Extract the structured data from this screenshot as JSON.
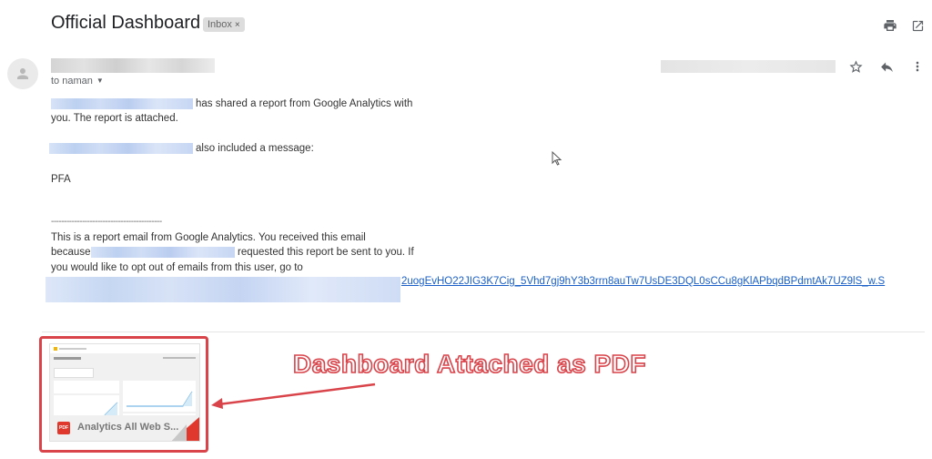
{
  "header": {
    "subject": "Official Dashboard",
    "label_badge": "Inbox",
    "label_remove": "×",
    "print_icon": "print-icon",
    "popout_icon": "open-in-new-window-icon"
  },
  "message": {
    "sender_name": "[redacted]",
    "to_line": "to naman",
    "date": "[redacted]",
    "actions": {
      "star_icon": "star-icon",
      "reply_icon": "reply-icon",
      "more_icon": "more-vertical-icon"
    },
    "body": {
      "line1_suffix": "has shared a report from Google Analytics with",
      "line2": "you. The report is attached.",
      "line3_suffix": "also included a message:",
      "message_text": "PFA",
      "separator": "-------------------------------------------",
      "footer_line1": "This is a report email from Google Analytics. You received this email",
      "footer_line2_prefix": "because",
      "footer_line2_suffix": "requested this report be sent to you. If",
      "footer_line3": "you would like to opt out of emails from this user, go to",
      "optout_link_visible": "2uogEvHO22JIG3K7Cig_5Vhd7gj9hY3b3rrn8auTw7UsDE3DQL0sCCu8gKlAPbqdBPdmtAk7UZ9lS_w.S"
    }
  },
  "attachment": {
    "file_type": "PDF",
    "file_name": "Analytics All Web S..."
  },
  "annotation": {
    "text": "Dashboard Attached as PDF",
    "color": "#d9434a"
  }
}
